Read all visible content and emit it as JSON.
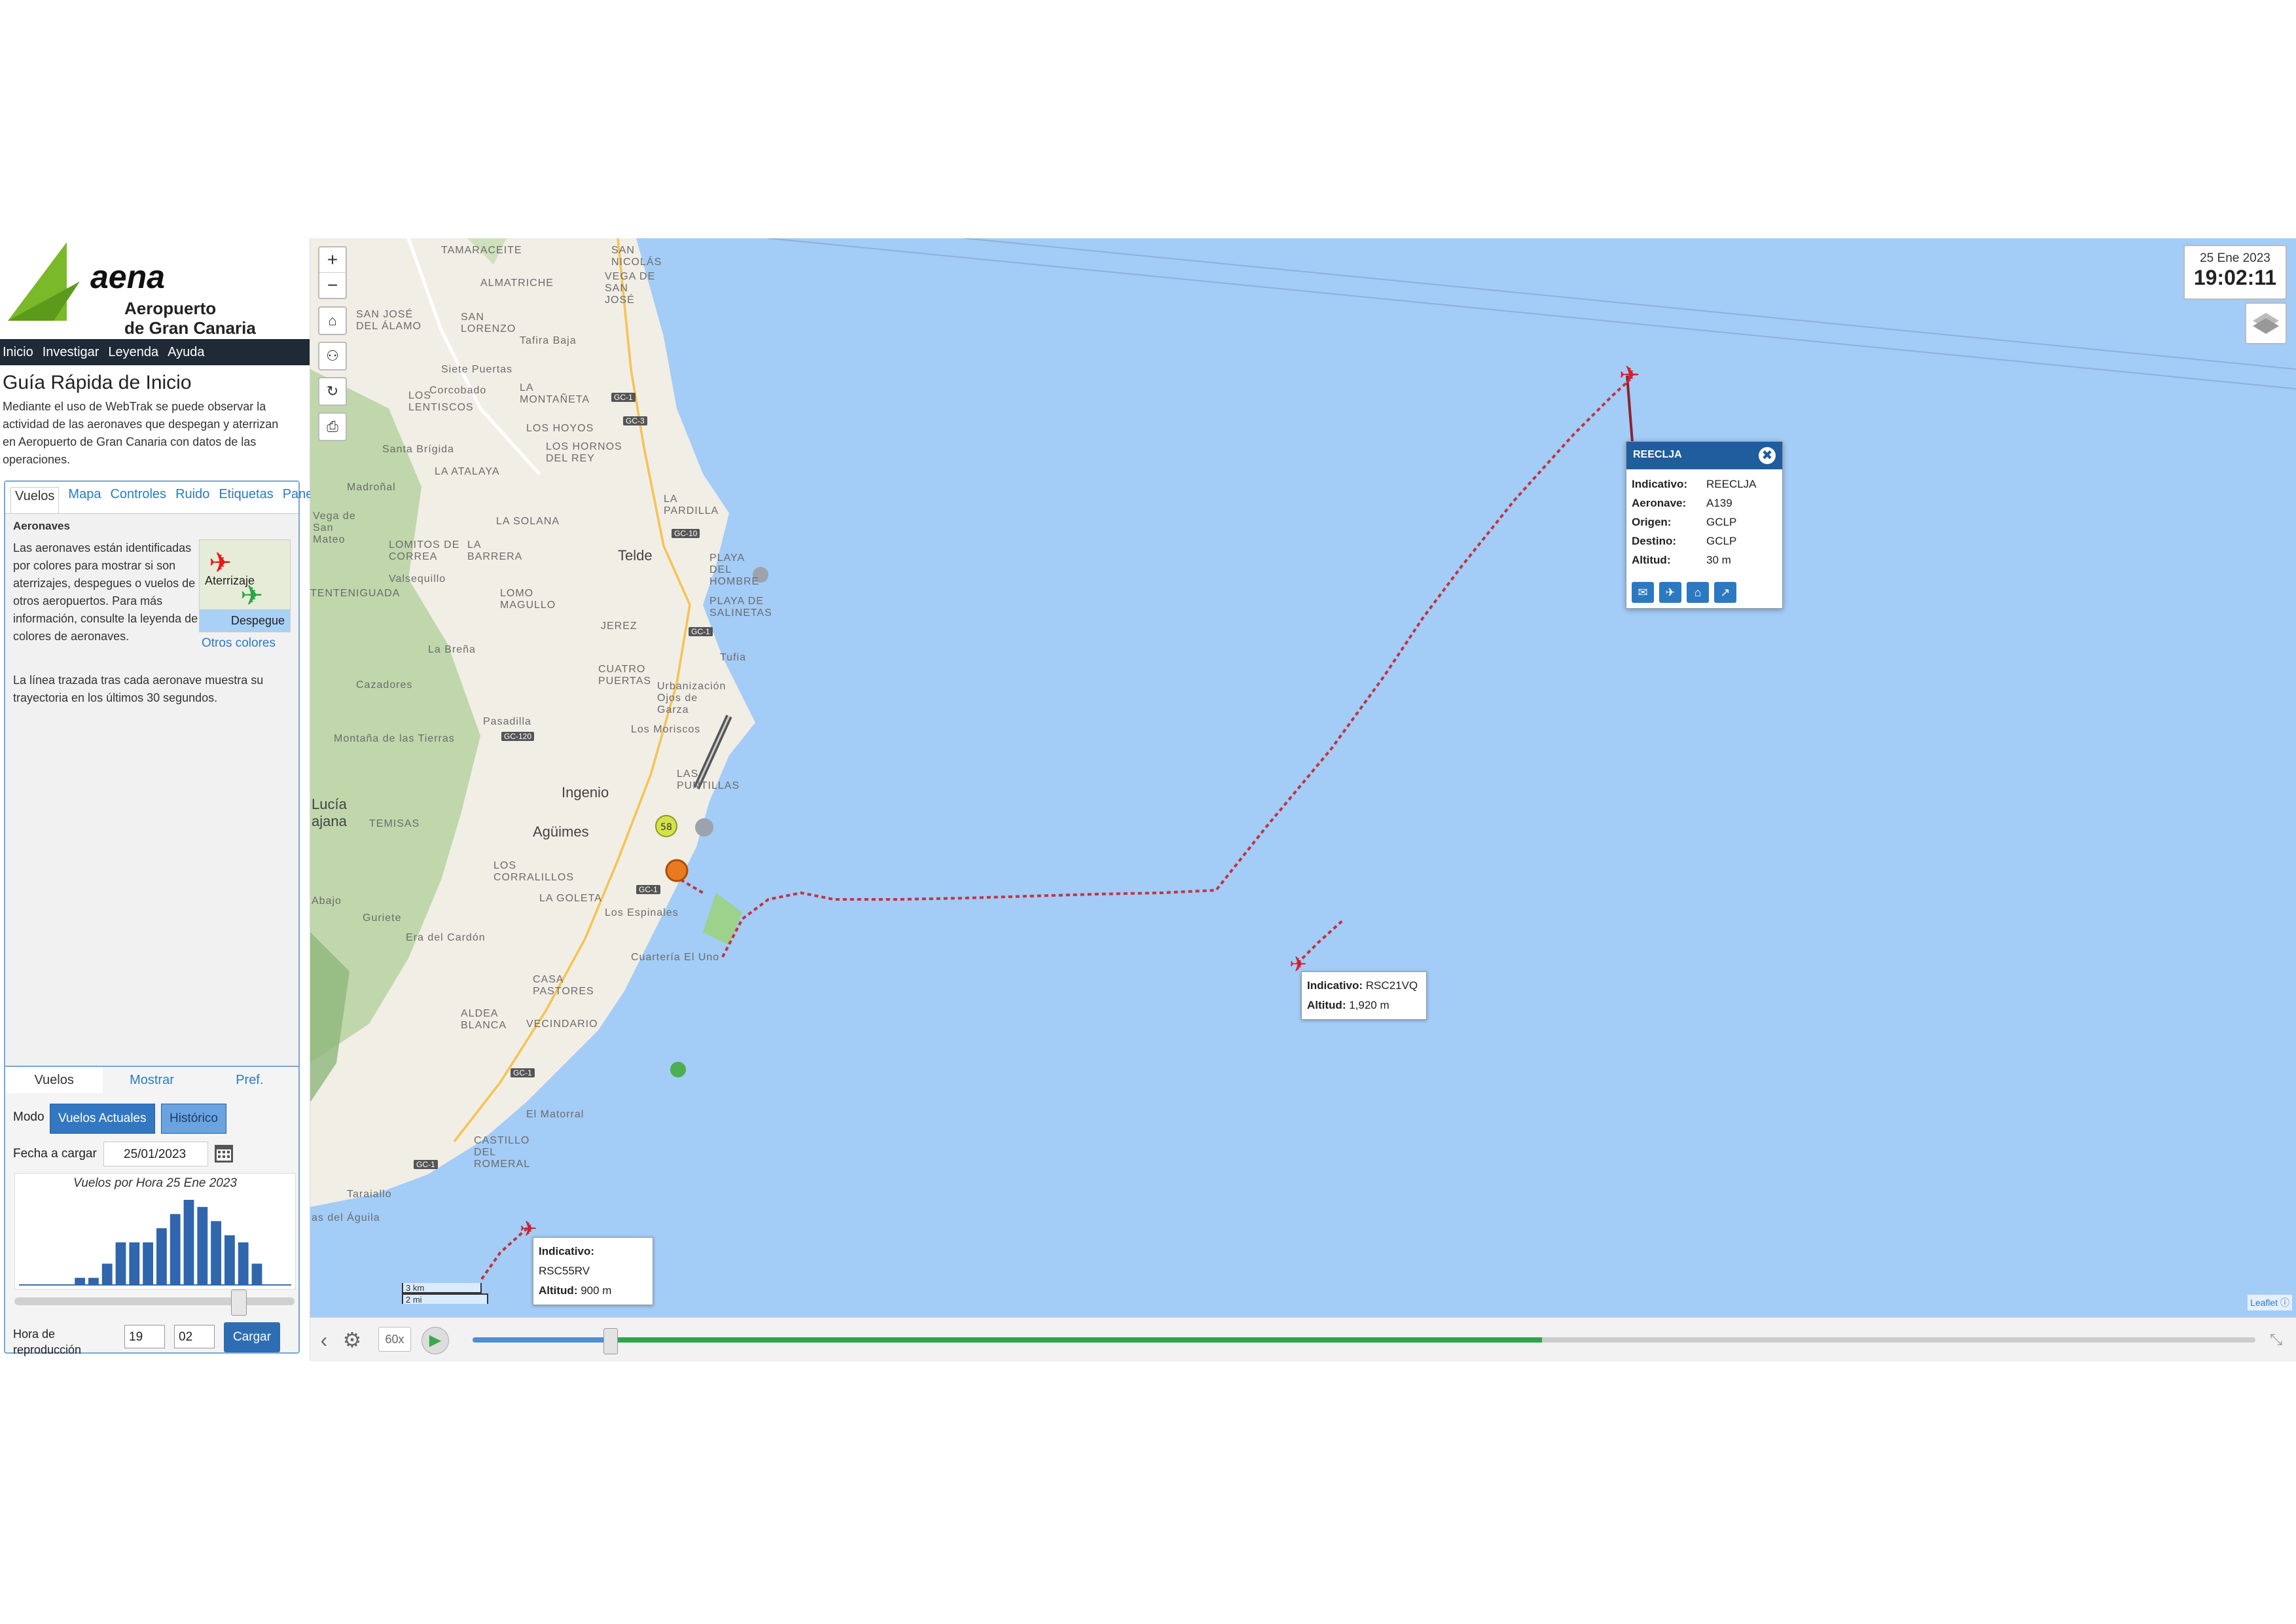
{
  "brand": {
    "name": "aena",
    "airport_line1": "Aeropuerto",
    "airport_line2": "de Gran Canaria",
    "colors": {
      "green": "#7ab929",
      "nav": "#1f2a36",
      "accent": "#2a7ac8"
    }
  },
  "topnav": [
    "Inicio",
    "Investigar",
    "Leyenda",
    "Ayuda"
  ],
  "guide": {
    "title": "Guía Rápida de Inicio",
    "text": "Mediante el uso de WebTrak se puede observar la actividad de las aeronaves que despegan y aterrizan en Aeropuerto de Gran Canaria con datos de las operaciones."
  },
  "info_panel": {
    "tabs": [
      "Vuelos",
      "Mapa",
      "Controles",
      "Ruido",
      "Etiquetas",
      "Paneles"
    ],
    "active_tab": "Vuelos",
    "section_title": "Aeronaves",
    "text": "Las aeronaves están identificadas por colores para mostrar si son aterrizajes, despegues o vuelos de otros aeropuertos. Para más información, consulte la leyenda de colores de aeronaves.",
    "legend_landing": "Aterrizaje",
    "legend_takeoff": "Despegue",
    "other_colors_link": "Otros colores",
    "trajectory_text": "La línea trazada tras cada aeronave muestra su trayectoria en los últimos 30 segundos."
  },
  "flights_panel": {
    "tabs": [
      "Vuelos",
      "Mostrar",
      "Pref."
    ],
    "mode_label": "Modo",
    "mode_buttons": [
      "Vuelos Actuales",
      "Histórico"
    ],
    "date_label": "Fecha a cargar",
    "date_value": "25/01/2023",
    "histogram_title": "Vuelos por Hora 25 Ene 2023",
    "histogram_values": [
      0,
      0,
      0,
      0,
      1,
      1,
      3,
      6,
      6,
      6,
      8,
      10,
      12,
      11,
      9,
      7,
      6,
      3,
      0,
      0
    ],
    "slider_fraction": 0.8,
    "hora_label": "Hora de reproducción",
    "hour_value": "19",
    "minute_value": "02",
    "load_button": "Cargar"
  },
  "map": {
    "clock_date": "25 Ene 2023",
    "clock_time": "19:02:11",
    "zoom_in": "+",
    "zoom_out": "−",
    "places": [
      "TAMARACEITE",
      "ALMATRICHE",
      "SAN NICOLÁS",
      "VEGA DE SAN JOSÉ",
      "SAN JOSÉ DEL ÁLAMO",
      "SAN LORENZO",
      "Tafira Baja",
      "Siete Puertas",
      "Corcobado",
      "LOS LENTISCOS",
      "LA MONTAÑETA",
      "LOS HOYOS",
      "Santa Brígida",
      "LOS HORNOS DEL REY",
      "LA ATALAYA",
      "Madroñal",
      "LA PARDILLA",
      "LA SOLANA",
      "Vega de San Mateo",
      "LOMITOS DE CORREA",
      "LA BARRERA",
      "Telde",
      "PLAYA DEL HOMBRE",
      "Valsequillo",
      "TENTENIGUADA",
      "LOMO MAGULLO",
      "PLAYA DE SALINETAS",
      "JEREZ",
      "La Breña",
      "Tufia",
      "CUATRO PUERTAS",
      "Urbanización Ojos de Garza",
      "Cazadores",
      "Pasadilla",
      "Los Moriscos",
      "Montaña de las Tierras",
      "Ingenio",
      "LAS PUNTILLAS",
      "Lucía",
      "ajana",
      "TEMISAS",
      "Agüimes",
      "LOS CORRALILLOS",
      "Abajo",
      "LA GOLETA",
      "Guriete",
      "Los Espinales",
      "Era del Cardón",
      "Cuartería El Uno",
      "CASA PASTORES",
      "ALDEA BLANCA",
      "VECINDARIO",
      "El Matorral",
      "CASTILLO DEL ROMERAL",
      "Taraiallo",
      "as del Águila"
    ],
    "roads": [
      "GC-1",
      "GC-3",
      "GC-10",
      "GC-1",
      "GC-120",
      "GC-1",
      "GC-1",
      "GC-1"
    ],
    "popup": {
      "header": "REECLJA",
      "rows": [
        {
          "label": "Indicativo:",
          "value": "REECLJA"
        },
        {
          "label": "Aeronave:",
          "value": "A139"
        },
        {
          "label": "Origen:",
          "value": "GCLP"
        },
        {
          "label": "Destino:",
          "value": "GCLP"
        },
        {
          "label": "Altitud:",
          "value": "30 m"
        }
      ]
    },
    "tooltips": [
      {
        "indicativo_label": "Indicativo:",
        "indicativo": "RSC21VQ",
        "altitud_label": "Altitud:",
        "altitud": "1,920 m"
      },
      {
        "indicativo_label": "Indicativo:",
        "indicativo": "RSC55RV",
        "altitud_label": "Altitud:",
        "altitud": "900 m"
      }
    ],
    "marker_label": "58",
    "scale_km": "3 km",
    "scale_mi": "2 mi",
    "attribution": "Leaflet"
  },
  "playback": {
    "speed": "60x",
    "progress_fraction": 0.6
  }
}
